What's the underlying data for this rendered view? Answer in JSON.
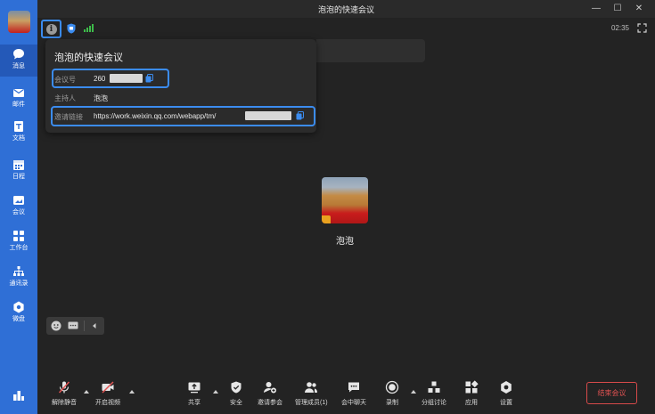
{
  "window": {
    "title": "泡泡的快速会议",
    "clock": "02:35"
  },
  "sidebar": {
    "items": [
      {
        "label": "消息",
        "icon": "chat-bubble-icon"
      },
      {
        "label": "邮件",
        "icon": "mail-icon"
      },
      {
        "label": "文档",
        "icon": "document-icon"
      },
      {
        "label": "日程",
        "icon": "calendar-icon"
      },
      {
        "label": "会议",
        "icon": "meeting-icon"
      },
      {
        "label": "工作台",
        "icon": "workbench-icon"
      },
      {
        "label": "通讯录",
        "icon": "contacts-icon"
      },
      {
        "label": "微盘",
        "icon": "drive-icon"
      }
    ]
  },
  "meeting_info": {
    "title": "泡泡的快速会议",
    "meeting_id_label": "会议号",
    "meeting_id_visible": "260",
    "host_label": "主持人",
    "host_value": "泡泡",
    "link_label": "邀请链接",
    "link_visible": "https://work.weixin.qq.com/webapp/tm/"
  },
  "participant": {
    "name": "泡泡"
  },
  "toolbar": {
    "unmute": "解除静音",
    "start_video": "开启视频",
    "share": "共享",
    "security": "安全",
    "invite": "邀请参会",
    "manage_members": "管理成员(1)",
    "chat": "会中聊天",
    "record": "录制",
    "breakout": "分组讨论",
    "apps": "应用",
    "settings": "设置",
    "end_meeting": "结束会议"
  },
  "colors": {
    "sidebar": "#2f6fd6",
    "highlight": "#3b8cf0",
    "end_button": "#e05252",
    "signal": "#3dbb4a"
  }
}
